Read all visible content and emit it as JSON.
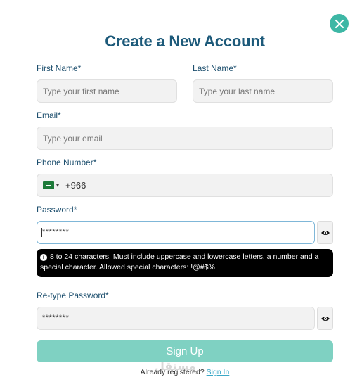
{
  "title": "Create a New Account",
  "first_name": {
    "label": "First Name*",
    "placeholder": "Type your first name"
  },
  "last_name": {
    "label": "Last Name*",
    "placeholder": "Type your last name"
  },
  "email": {
    "label": "Email*",
    "placeholder": "Type your email"
  },
  "phone": {
    "label": "Phone Number*",
    "country_code": "+966",
    "flag_icon": "saudi-flag-icon"
  },
  "password": {
    "label": "Password*",
    "masked_value": "********"
  },
  "tooltip": {
    "text": "8 to 24 characters. Must include uppercase and lowercase letters, a number and a special character. Allowed special characters: !@#$%"
  },
  "retype_password": {
    "label": "Re-type Password*",
    "masked_value": "********"
  },
  "signup": {
    "label": "Sign Up"
  },
  "footer": {
    "prefix": "Already registered? ",
    "link": "Sign In"
  },
  "watermark": "مستقل",
  "colors": {
    "accent": "#3db7a5",
    "title": "#1d5a7a",
    "signup_bg": "#7fd1c2",
    "link": "#3aa8c7"
  }
}
